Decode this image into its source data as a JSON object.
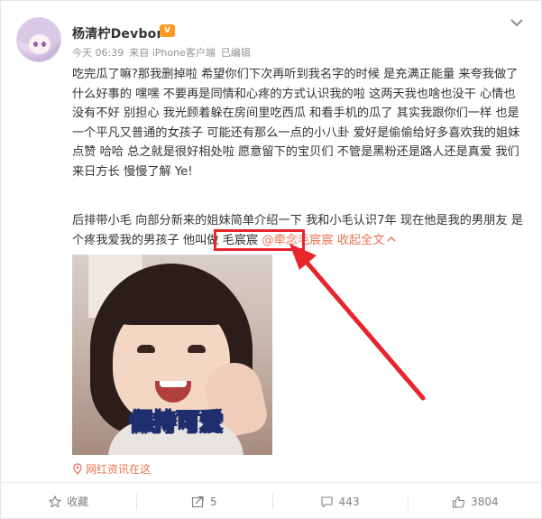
{
  "post": {
    "username": "杨清柠Devbor",
    "badge": "V",
    "meta": {
      "time": "今天 06:39",
      "source": "来自 iPhone客户端",
      "edited": "已编辑"
    },
    "para1": "吃完瓜了嘛?那我删掉啦 希望你们下次再听到我名字的时候 是充满正能量 来夸我做了什么好事的 嘿嘿 不要再是同情和心疼的方式认识我的啦 这两天我也啥也没干 心情也没有不好 别担心 我光顾着躲在房间里吃西瓜 和看手机的瓜了 其实我跟你们一样 也是一个平凡又普通的女孩子 可能还有那么一点的小八卦 爱好是偷偷给好多喜欢我的姐妹点赞 哈哈 总之就是很好相处啦 愿意留下的宝贝们 不管是黑粉还是路人还是真爱 我们来日方长 慢慢了解 Ye!",
    "para2_prefix": "后排带小毛 向部分新来的姐妹简单介绍一下 我和小毛认识7年 现在他是我的男朋友 是个疼我爱我的男孩子 他叫做 毛宸宸 ",
    "mention": "@牵念毛宸宸",
    "collapse": " 收起全文",
    "image_caption": "保持可爱",
    "location": "网红资讯在这"
  },
  "footer": {
    "favorite": "收藏",
    "repost": "5",
    "comment": "443",
    "like": "3804"
  },
  "colors": {
    "link": "#eb7350",
    "annotation": "#e8242c",
    "badge": "#ff9a1f"
  },
  "icons": [
    "chevron-down-icon",
    "location-pin-icon",
    "star-icon",
    "repost-icon",
    "comment-icon",
    "thumbs-up-icon"
  ]
}
